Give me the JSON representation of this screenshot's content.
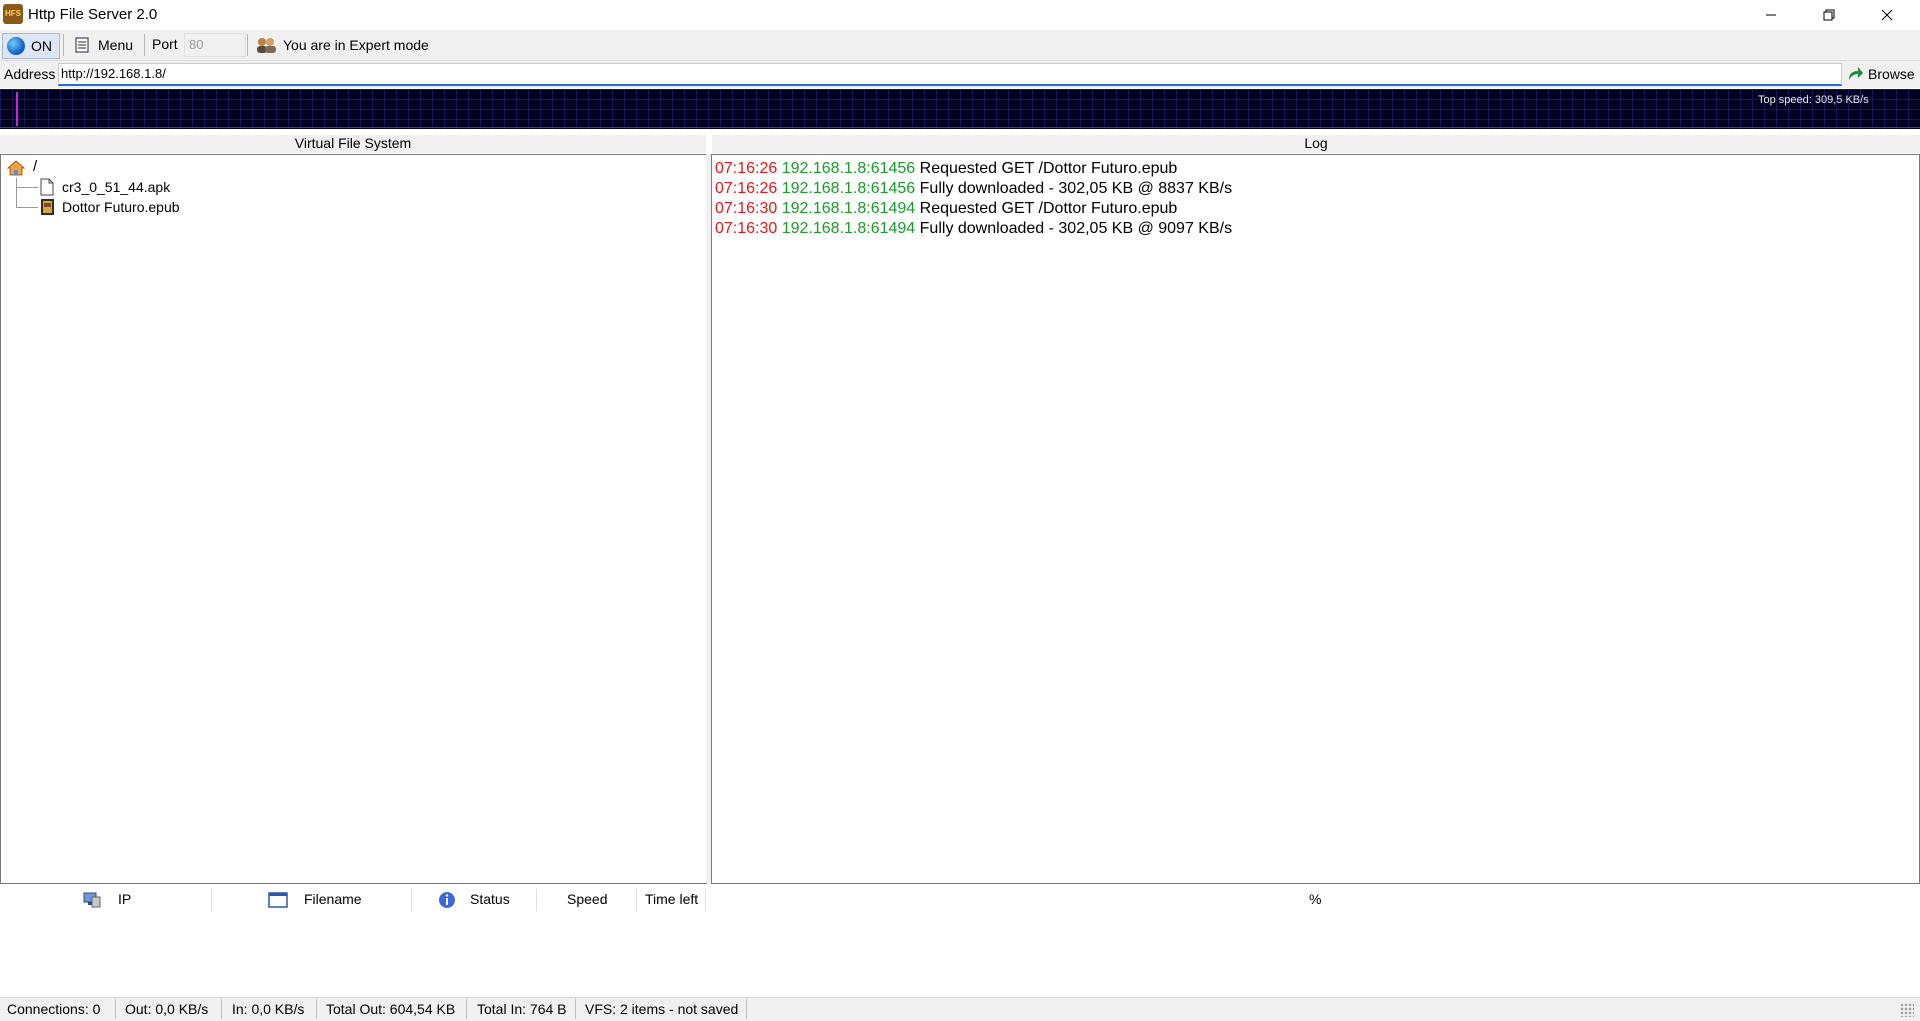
{
  "window": {
    "title": "Http File Server 2.0"
  },
  "toolbar": {
    "on_label": "ON",
    "menu_label": "Menu",
    "port_label": "Port",
    "port_value": "80",
    "mode_label": "You are in Expert mode"
  },
  "address": {
    "label": "Address",
    "value": "http://192.168.1.8/",
    "browse_label": "Browse"
  },
  "graph": {
    "top_speed": "Top speed: 309,5 KB/s"
  },
  "vfs": {
    "title": "Virtual File System",
    "root": "/",
    "items": [
      {
        "name": "cr3_0_51_44.apk",
        "icon": "file-icon"
      },
      {
        "name": "Dottor Futuro.epub",
        "icon": "epub-file-icon"
      }
    ]
  },
  "log": {
    "title": "Log",
    "entries": [
      {
        "time": "07:16:26",
        "address": "192.168.1.8:61456",
        "message": "Requested GET /Dottor Futuro.epub"
      },
      {
        "time": "07:16:26",
        "address": "192.168.1.8:61456",
        "message": "Fully downloaded - 302,05 KB @ 8837 KB/s"
      },
      {
        "time": "07:16:30",
        "address": "192.168.1.8:61494",
        "message": "Requested GET /Dottor Futuro.epub"
      },
      {
        "time": "07:16:30",
        "address": "192.168.1.8:61494",
        "message": "Fully downloaded - 302,05 KB @ 9097 KB/s"
      }
    ]
  },
  "connections": {
    "columns": {
      "ip": "IP",
      "filename": "Filename",
      "status": "Status",
      "speed": "Speed",
      "time_left": "Time left",
      "percent": "%"
    }
  },
  "statusbar": {
    "connections": "Connections: 0",
    "out": "Out: 0,0 KB/s",
    "in": "In: 0,0 KB/s",
    "total_out": "Total Out: 604,54 KB",
    "total_in": "Total In: 764 B",
    "vfs": "VFS: 2 items - not saved"
  },
  "colors": {
    "log_time": "#e01818",
    "log_address": "#1a9a2a",
    "graph_bg": "#000021",
    "graph_spike": "#d020d0"
  }
}
